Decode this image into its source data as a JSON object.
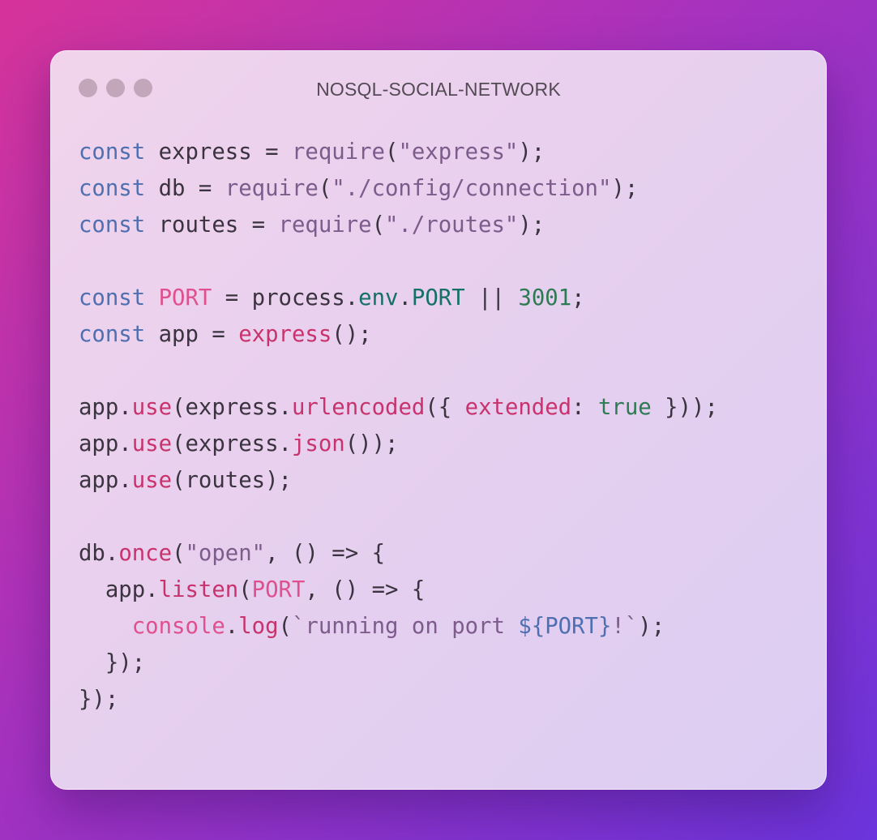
{
  "window": {
    "title": "NOSQL-SOCIAL-NETWORK",
    "traffic_lights": [
      "close",
      "minimize",
      "zoom"
    ],
    "colors": {
      "traffic_light": "#c3a6ba",
      "keyword": "#4f6fb0",
      "string": "#7d5c8c",
      "constant": "#e0508e",
      "property": "#15706a",
      "number": "#2e7a52",
      "method": "#c9336d"
    }
  },
  "code": {
    "language": "javascript",
    "lines": [
      [
        {
          "t": "const",
          "c": "keyword"
        },
        {
          "t": " express = ",
          "c": "plain"
        },
        {
          "t": "require",
          "c": "func-muted"
        },
        {
          "t": "(",
          "c": "plain"
        },
        {
          "t": "\"express\"",
          "c": "string"
        },
        {
          "t": ");",
          "c": "plain"
        }
      ],
      [
        {
          "t": "const",
          "c": "keyword"
        },
        {
          "t": " db = ",
          "c": "plain"
        },
        {
          "t": "require",
          "c": "func-muted"
        },
        {
          "t": "(",
          "c": "plain"
        },
        {
          "t": "\"./config/connection\"",
          "c": "string"
        },
        {
          "t": ");",
          "c": "plain"
        }
      ],
      [
        {
          "t": "const",
          "c": "keyword"
        },
        {
          "t": " routes = ",
          "c": "plain"
        },
        {
          "t": "require",
          "c": "func-muted"
        },
        {
          "t": "(",
          "c": "plain"
        },
        {
          "t": "\"./routes\"",
          "c": "string"
        },
        {
          "t": ");",
          "c": "plain"
        }
      ],
      [],
      [
        {
          "t": "const",
          "c": "keyword"
        },
        {
          "t": " ",
          "c": "plain"
        },
        {
          "t": "PORT",
          "c": "const"
        },
        {
          "t": " = process.",
          "c": "plain"
        },
        {
          "t": "env",
          "c": "property"
        },
        {
          "t": ".",
          "c": "plain"
        },
        {
          "t": "PORT",
          "c": "property"
        },
        {
          "t": " || ",
          "c": "plain"
        },
        {
          "t": "3001",
          "c": "number"
        },
        {
          "t": ";",
          "c": "plain"
        }
      ],
      [
        {
          "t": "const",
          "c": "keyword"
        },
        {
          "t": " app = ",
          "c": "plain"
        },
        {
          "t": "express",
          "c": "method"
        },
        {
          "t": "();",
          "c": "plain"
        }
      ],
      [],
      [
        {
          "t": "app.",
          "c": "plain"
        },
        {
          "t": "use",
          "c": "method"
        },
        {
          "t": "(express.",
          "c": "plain"
        },
        {
          "t": "urlencoded",
          "c": "method"
        },
        {
          "t": "({ ",
          "c": "plain"
        },
        {
          "t": "extended",
          "c": "method"
        },
        {
          "t": ": ",
          "c": "plain"
        },
        {
          "t": "true",
          "c": "bool"
        },
        {
          "t": " }));",
          "c": "plain"
        }
      ],
      [
        {
          "t": "app.",
          "c": "plain"
        },
        {
          "t": "use",
          "c": "method"
        },
        {
          "t": "(express.",
          "c": "plain"
        },
        {
          "t": "json",
          "c": "method"
        },
        {
          "t": "());",
          "c": "plain"
        }
      ],
      [
        {
          "t": "app.",
          "c": "plain"
        },
        {
          "t": "use",
          "c": "method"
        },
        {
          "t": "(routes);",
          "c": "plain"
        }
      ],
      [],
      [
        {
          "t": "db.",
          "c": "plain"
        },
        {
          "t": "once",
          "c": "method"
        },
        {
          "t": "(",
          "c": "plain"
        },
        {
          "t": "\"open\"",
          "c": "string"
        },
        {
          "t": ", () => {",
          "c": "plain"
        }
      ],
      [
        {
          "t": "  app.",
          "c": "plain"
        },
        {
          "t": "listen",
          "c": "method"
        },
        {
          "t": "(",
          "c": "plain"
        },
        {
          "t": "PORT",
          "c": "const"
        },
        {
          "t": ", () => {",
          "c": "plain"
        }
      ],
      [
        {
          "t": "    ",
          "c": "plain"
        },
        {
          "t": "console",
          "c": "const"
        },
        {
          "t": ".",
          "c": "plain"
        },
        {
          "t": "log",
          "c": "method"
        },
        {
          "t": "(",
          "c": "plain"
        },
        {
          "t": "`running on port ",
          "c": "string"
        },
        {
          "t": "${PORT}",
          "c": "interp"
        },
        {
          "t": "!`",
          "c": "string"
        },
        {
          "t": ");",
          "c": "plain"
        }
      ],
      [
        {
          "t": "  });",
          "c": "plain"
        }
      ],
      [
        {
          "t": "});",
          "c": "plain"
        }
      ]
    ]
  }
}
